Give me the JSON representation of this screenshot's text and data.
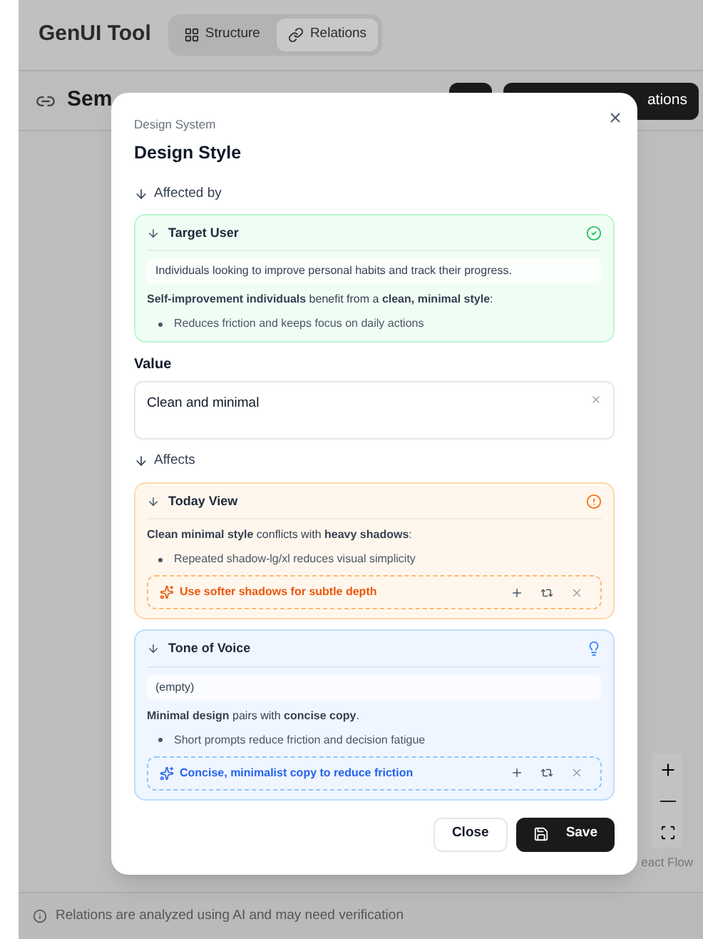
{
  "app": {
    "title": "GenUI Tool",
    "tabs": [
      {
        "label": "Structure",
        "selected": false,
        "kind": "structure"
      },
      {
        "label": "Relations",
        "selected": true,
        "kind": "relations"
      }
    ]
  },
  "toolbar": {
    "title": "Sem",
    "action_button": "ations"
  },
  "canvas": {
    "attribution": "eact Flow"
  },
  "dialog": {
    "category": "Design System",
    "title": "Design Style",
    "affected_by": {
      "heading": "Affected by",
      "items": [
        {
          "name": "Target User",
          "kind": "match",
          "current": "Individuals looking to improve personal habits and track their progress.",
          "explanation": "**Self-improvement individuals** benefit from a **clean, minimal style**:",
          "points": [
            "Reduces friction and keeps focus on daily actions"
          ]
        }
      ]
    },
    "value": {
      "label": "Value",
      "text": "Clean and minimal"
    },
    "affects": {
      "heading": "Affects",
      "items": [
        {
          "name": "Today View",
          "kind": "conflict",
          "explanation": "**Clean minimal style** conflicts with **heavy shadows**:",
          "points": [
            "Repeated shadow-lg/xl reduces visual simplicity"
          ],
          "suggestion": "Use softer shadows for subtle depth"
        },
        {
          "name": "Tone of Voice",
          "kind": "idea",
          "current": "(empty)",
          "explanation": "**Minimal design** pairs with **concise copy**.",
          "points": [
            "Short prompts reduce friction and decision fatigue"
          ],
          "suggestion": "Concise, minimalist copy to reduce friction"
        }
      ]
    },
    "buttons": {
      "close": "Close",
      "save": "Save"
    }
  },
  "footer": {
    "note": "Relations are analyzed using AI and may need verification"
  }
}
